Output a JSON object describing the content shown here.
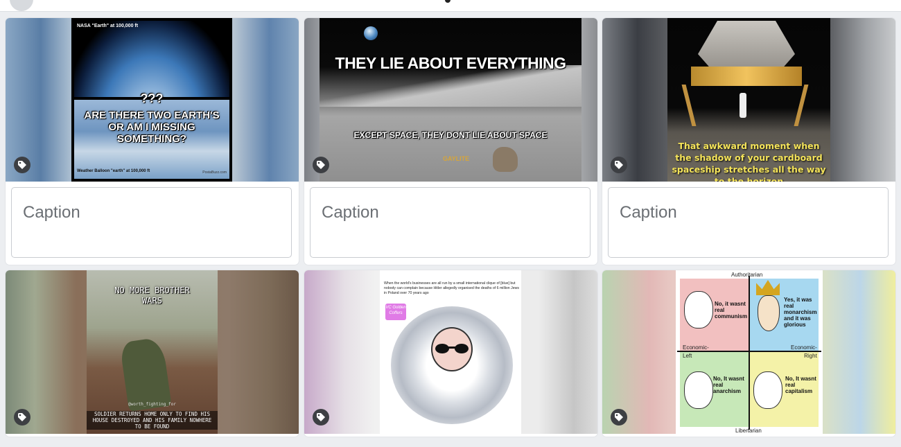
{
  "caption_placeholder": "Caption",
  "cards": [
    {
      "title_top": "NASA \"Earth\" at 100,000 ft",
      "question": "???",
      "main_text": "ARE THERE TWO EARTH'S OR AM I MISSING SOMETHING?",
      "bottom_left": "Weather Balloon \"earth\" at 100,000 ft",
      "bottom_right": "PostaBuzz.com"
    },
    {
      "top_text": "THEY LIE ABOUT EVERYTHING",
      "bottom_text": "EXCEPT SPACE, THEY DONT LIE ABOUT SPACE",
      "watermark": "GAYLITE"
    },
    {
      "caption_text": "That awkward moment when the shadow of your cardboard spaceship stretches all the way to the horizon"
    },
    {
      "top_text": "NO MORE BROTHER WARS",
      "credit": "@worth_fighting_for",
      "bottom_text": "SOLDIER RETURNS HOME ONLY TO FIND HIS HOUSE DESTROYED AND HIS FAMILY NOWHERE TO BE FOUND"
    },
    {
      "top_text": "When the world's businesses are all run by a small international clique of [blue] but nobody can complain because Hitler allegedly organised the deaths of 6 million Jews in Poland over 70 years ago",
      "label": "VC Golden Coffers"
    },
    {
      "axis_top": "Authoritarian",
      "axis_bottom": "Libertarian",
      "axis_left": "Economic-\nLeft",
      "axis_right": "Economic-\nRight",
      "q1": "No, it wasnt real communism",
      "q2": "Yes, it was real monarchism and it was glorious",
      "q3": "No, It wasnt real anarchism",
      "q4": "No, It wasnt real capitalism"
    }
  ]
}
